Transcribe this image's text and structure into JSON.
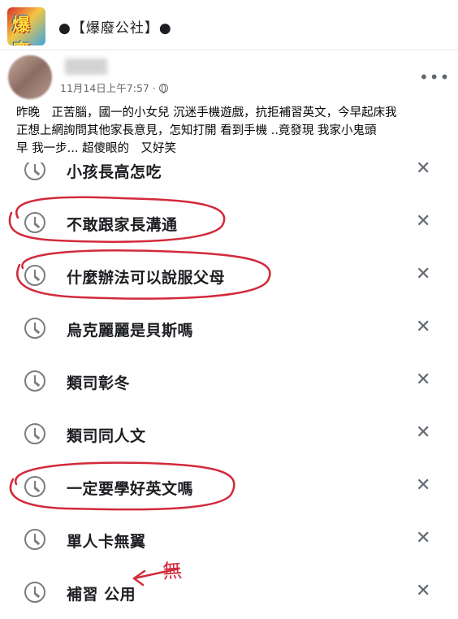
{
  "group": {
    "name": "●【爆廢公社】●",
    "logo_icon": "group-logo-icon",
    "logo_text": "爆廢"
  },
  "post": {
    "timestamp": "11月14日上午7:57 ·",
    "audience_icon": "globe-icon",
    "more_label": "•••",
    "text_lines": [
      "昨晚　正苦腦，國一的小女兒 沉迷手機遊戲，抗拒補習英文，今早起床我",
      "正想上網詢問其他家長意見，怎知打開 看到手機 ..竟發現 我家小鬼頭",
      "早 我一步... 超傻眼的　又好笑"
    ]
  },
  "search_history": {
    "remove_label": "✕",
    "items": [
      {
        "label": "小孩長高怎吃",
        "circled": false
      },
      {
        "label": "不敢跟家長溝通",
        "circled": true
      },
      {
        "label": "什麼辦法可以說服父母",
        "circled": true
      },
      {
        "label": "烏克麗麗是貝斯嗎",
        "circled": false
      },
      {
        "label": "類司彰冬",
        "circled": false
      },
      {
        "label": "類司同人文",
        "circled": false
      },
      {
        "label": "一定要學好英文嗎",
        "circled": true
      },
      {
        "label": "單人卡無翼",
        "circled": false
      },
      {
        "label": "補習 公用",
        "circled": false
      }
    ]
  },
  "annotation": {
    "handwritten": "無",
    "color": "#d22a3b"
  }
}
